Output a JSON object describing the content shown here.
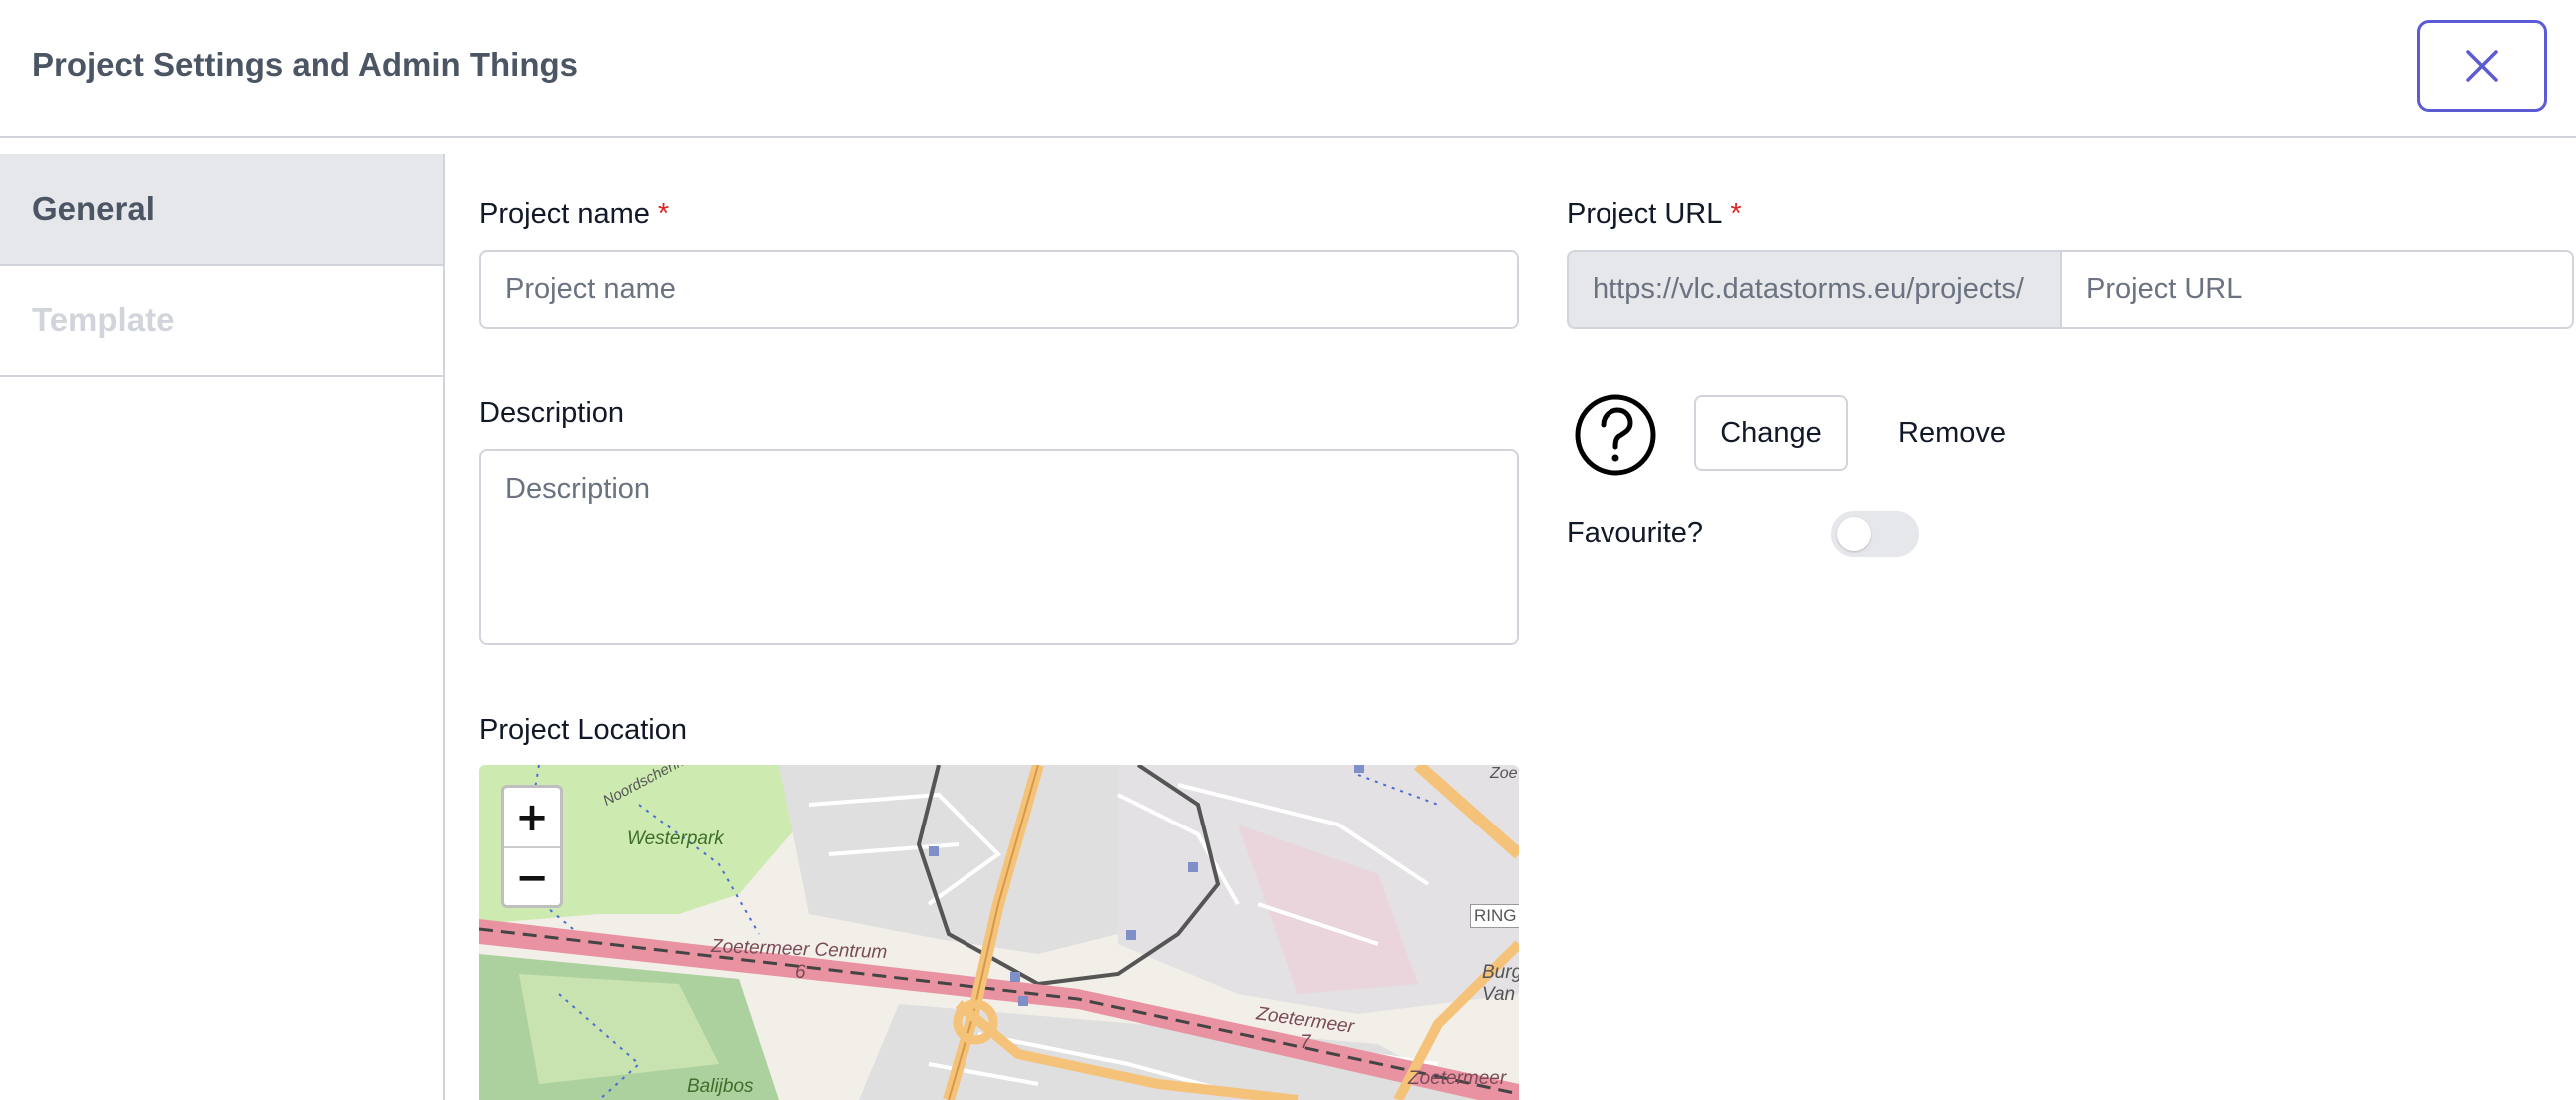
{
  "header": {
    "title": "Project Settings and Admin Things",
    "close_icon": "close-icon"
  },
  "sidebar": {
    "items": [
      {
        "label": "General",
        "active": true
      },
      {
        "label": "Template",
        "active": false
      }
    ]
  },
  "form": {
    "project_name": {
      "label": "Project name",
      "required_mark": "*",
      "placeholder": "Project name",
      "value": ""
    },
    "description": {
      "label": "Description",
      "placeholder": "Description",
      "value": ""
    },
    "location": {
      "label": "Project Location"
    },
    "project_url": {
      "label": "Project URL",
      "required_mark": "*",
      "prefix": "https://vlc.datastorms.eu/projects/",
      "placeholder": "Project URL",
      "value": ""
    },
    "icon": {
      "name": "question-circle-icon",
      "change_label": "Change",
      "remove_label": "Remove"
    },
    "favourite": {
      "label": "Favourite?",
      "checked": false
    }
  },
  "map": {
    "zoom_in_label": "+",
    "zoom_out_label": "−",
    "labels": {
      "westerpark": "Westerpark",
      "zoetermeer_centrum": "Zoetermeer Centrum",
      "zoetermeer_1": "Zoetermeer",
      "zoetermeer_2": "Zoetermeer",
      "balijbos": "Balijbos",
      "ring": "RING",
      "burg": "Burg",
      "van": "Van",
      "six": "6",
      "seven": "7",
      "top_left": "Noordschenk",
      "top_right": "Zoe"
    }
  },
  "colors": {
    "accent": "#5b5bd6",
    "required": "#dc2626",
    "border": "#d1d5db",
    "sidebar_active_bg": "#e5e7eb"
  }
}
